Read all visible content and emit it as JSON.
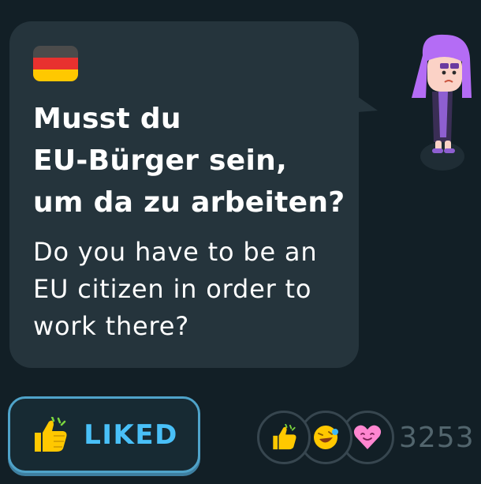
{
  "card": {
    "flag_icon": "germany-flag-icon",
    "sentence": "Musst du\nEU-Bürger sein,\num da zu arbeiten?",
    "translation": "Do you have to be an\nEU citizen in order to\nwork there?"
  },
  "character": {
    "icon": "purple-haired-character"
  },
  "like_button": {
    "icon": "thumbs-up-icon",
    "label": "LIKED",
    "accent_color": "#49c0f8"
  },
  "reactions": {
    "icons": [
      "thumbs-up-icon",
      "laughing-emoji-icon",
      "heart-face-icon"
    ],
    "count": "3253"
  },
  "colors": {
    "background": "#121f26",
    "card": "#25343c",
    "text": "#ffffff",
    "muted": "#52656d"
  }
}
